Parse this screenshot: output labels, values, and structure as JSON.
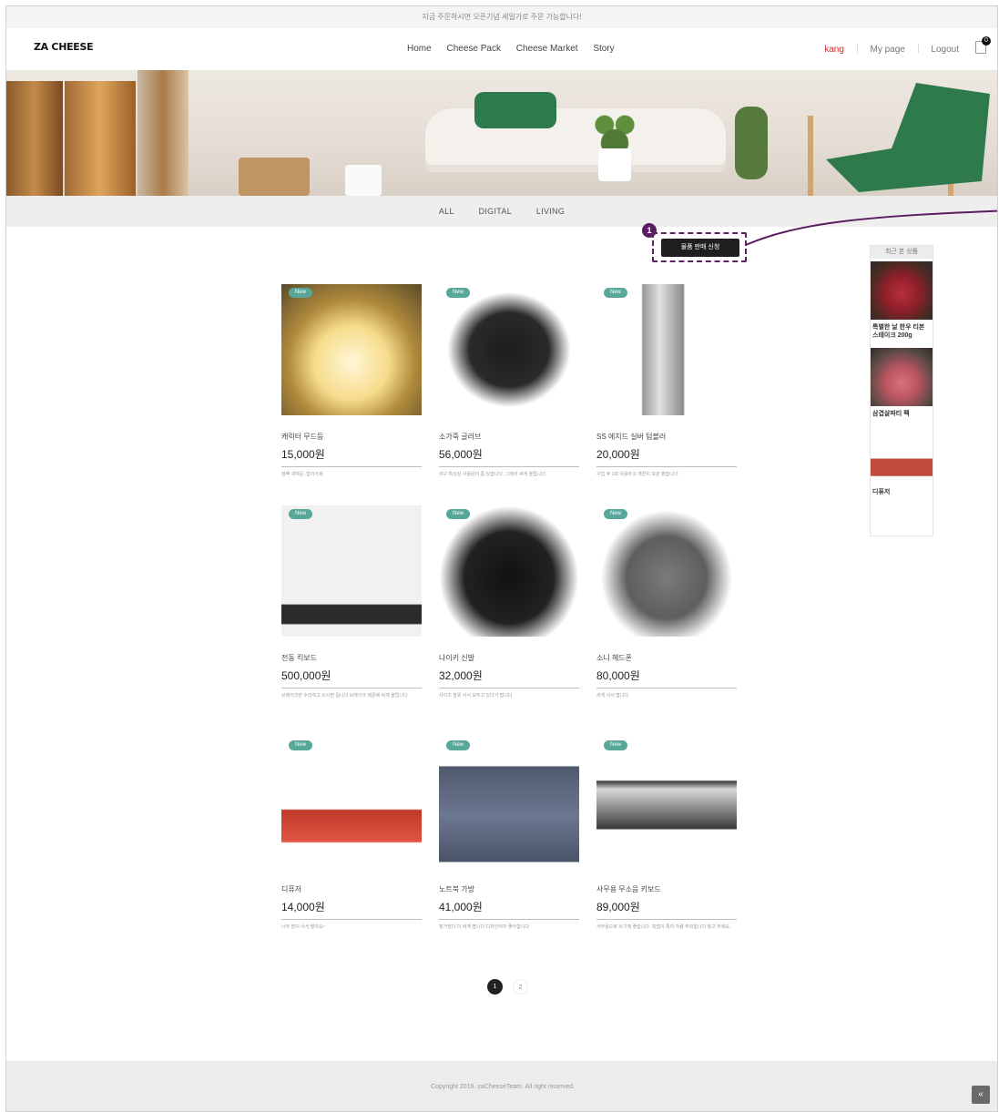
{
  "notice": "지금 주문하시면 오픈기념 세일가로 주문 가능합니다!",
  "header": {
    "logo": "ZA CHEESE",
    "menu": [
      "Home",
      "Cheese Pack",
      "Cheese Market",
      "Story"
    ],
    "user": "kang",
    "mypage": "My page",
    "logout": "Logout",
    "cart_count": "0"
  },
  "categories": [
    "ALL",
    "DIGITAL",
    "LIVING"
  ],
  "apply_button": "물품 판매 신청",
  "step_marker": "1",
  "recent": {
    "title": "최근 본 상품",
    "items": [
      "특별한 날 한우 티본 스테이크 200g",
      "삼겹살파티 팩",
      "디퓨저"
    ]
  },
  "products": [
    {
      "tag": "New",
      "name": "캐릭터 무드등",
      "price": "15,000원",
      "desc": "컴팩 귀여운, 업어가세"
    },
    {
      "tag": "New",
      "name": "소가죽 글러브",
      "price": "56,000원",
      "desc": "야구 특성상 사용감이 좀 있습니다. 그래서 싸게 올립니다."
    },
    {
      "tag": "New",
      "name": "SS 에치드 실버 텀블러",
      "price": "20,000원",
      "desc": "구입 후 1회 사용하고 깨끗이 보관 했습니다."
    },
    {
      "tag": "New",
      "name": "전동 킥보드",
      "price": "500,000원",
      "desc": "브레이크만 수리하고 쓰시면 됩니다 브레이크 때문에 싸게 올립니다"
    },
    {
      "tag": "New",
      "name": "나이키 신발",
      "price": "32,000원",
      "desc": "사이즈 잘못 사서 보두고 있다가 팝니다"
    },
    {
      "tag": "New",
      "name": "소니 헤드폰",
      "price": "80,000원",
      "desc": "싸게 사서 팝니다."
    },
    {
      "tag": "New",
      "name": "디퓨저",
      "price": "14,000원",
      "desc": "너무 많이 사서 팔아요~"
    },
    {
      "tag": "New",
      "name": "노트북 가방",
      "price": "41,000원",
      "desc": "짐가방다 더 싸게 팝니다 디자인까지 좋아합니다"
    },
    {
      "tag": "New",
      "name": "사무용 무소음 키보드",
      "price": "89,000원",
      "desc": "사무용으로 쓰기에 좋습니다. 직접이 특히 저렴 주의합니다 참고 하세요."
    }
  ],
  "pagination": [
    "1",
    "2"
  ],
  "footer": "Copyright 2019. zaCheeseTeam. All right reserved.",
  "to_top": "«"
}
